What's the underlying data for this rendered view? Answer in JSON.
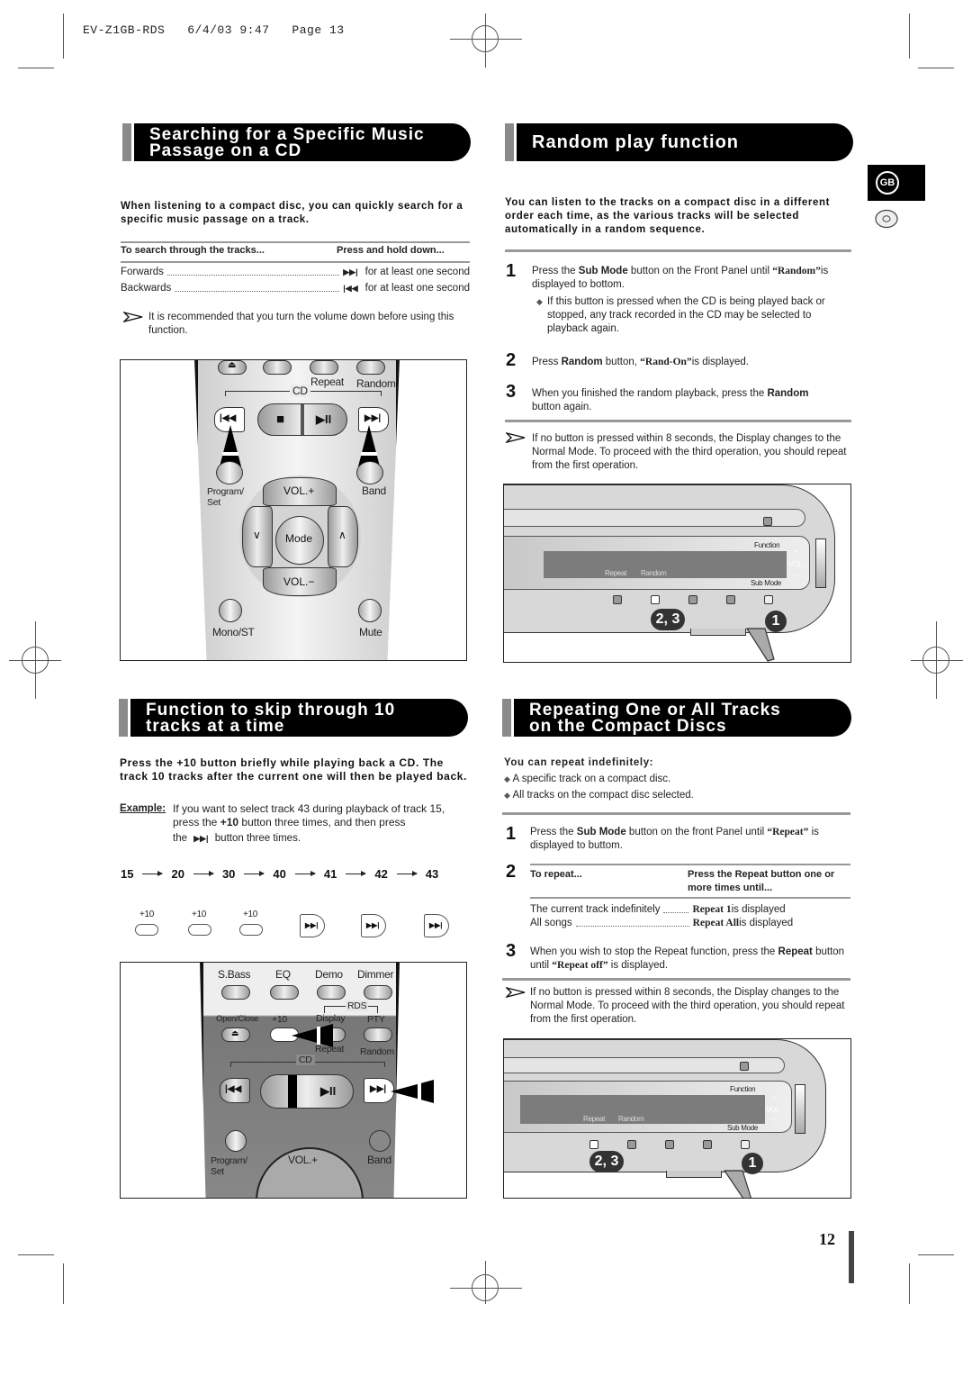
{
  "print_header": "EV-Z1GB-RDS   6/4/03 9:47   Page 13",
  "language_tab": "GB",
  "page_number": "12",
  "search_section": {
    "title_line1": "Searching for a Specific Music",
    "title_line2": "Passage on a CD",
    "intro": "When listening to a compact disc, you can quickly search for a specific music passage on a track.",
    "table": {
      "header_left": "To search through the tracks...",
      "header_right": "Press and hold down...",
      "rows": [
        {
          "direction": "Forwards",
          "icon": "skip-forward-icon",
          "glyph": "▶▶|",
          "duration": "for at least one second"
        },
        {
          "direction": "Backwards",
          "icon": "skip-back-icon",
          "glyph": "|◀◀",
          "duration": "for at least one second"
        }
      ]
    },
    "note": "It is recommended that you turn the volume down before using this function."
  },
  "remote_1": {
    "cd_label": "CD",
    "repeat": "Repeat",
    "random": "Random",
    "eject_glyph": "⏏",
    "stop_glyph": "■",
    "play_pause_glyph": "▶II",
    "prev_glyph": "|◀◀",
    "next_glyph": "▶▶|",
    "program_set": "Program/\nSet",
    "band": "Band",
    "vol_up": "VOL.+",
    "vol_down": "VOL.−",
    "mode": "Mode",
    "down": "∨",
    "up": "∧",
    "mono_st": "Mono/ST",
    "mute": "Mute"
  },
  "random_section": {
    "title": "Random play function",
    "intro": "You can listen to the tracks on a compact disc in a different order each time, as the various tracks will be selected automatically in a random sequence.",
    "steps": [
      {
        "num": "1",
        "pre": "Press the ",
        "bold": "Sub Mode",
        "mid": " button on the Front Panel until ",
        "serif": "“Random”",
        "post": "is displayed to bottom."
      },
      {
        "num": "2",
        "pre": "Press ",
        "bold": "Random",
        "mid": " button, ",
        "serif": "“Rand-On”",
        "post": "is displayed."
      },
      {
        "num": "3",
        "pre": "When you finished the random playback, press the ",
        "bold": "Random",
        "post": " button again."
      }
    ],
    "step1_sub": "If this button is pressed when the CD is being played back or stopped, any track recorded in the CD may be selected to playback again.",
    "note": "If no button is pressed within 8 seconds, the Display changes to the Normal Mode. To proceed with the third operation, you should repeat from the first operation."
  },
  "panel_1": {
    "function": "Function",
    "repeat": "Repeat",
    "random": "Random",
    "sub_mode": "Sub Mode",
    "vol": "VOL.",
    "plus": "+",
    "minus": "—",
    "badge_a": "2, 3",
    "badge_b": "1"
  },
  "skip_section": {
    "title_line1": "Function to skip through 10",
    "title_line2": "tracks at a time",
    "intro": "Press the +10 button briefly while playing back a CD. The track 10 tracks after the current one will then be played back.",
    "example_label": "Example:",
    "example_pre": "If you want to select track 43 during playback of track 15, press the ",
    "example_bold": "+10",
    "example_mid": " button three times, and then press",
    "example_the": "the",
    "example_post": "button three times.",
    "sequence": [
      "15",
      "20",
      "30",
      "40",
      "41",
      "42",
      "43"
    ],
    "plus10_labels": [
      "+10",
      "+10",
      "+10"
    ],
    "next_glyph": "▶▶|"
  },
  "remote_2": {
    "sbass": "S.Bass",
    "eq": "EQ",
    "demo": "Demo",
    "dimmer": "Dimmer",
    "rds": "RDS",
    "open_close": "Open/Close",
    "plus10": "+10",
    "display": "Display",
    "pty": "PTY",
    "repeat": "Repeat",
    "random": "Random",
    "cd_label": "CD",
    "program_set": "Program/\nSet",
    "vol_up": "VOL.+",
    "band": "Band",
    "eject_glyph": "⏏",
    "prev_glyph": "|◀◀",
    "next_glyph": "▶▶|",
    "play_pause_glyph": "▶II"
  },
  "repeat_section": {
    "title_line1": "Repeating One or All Tracks",
    "title_line2": "on the Compact Discs",
    "subhead": "You can repeat indefinitely:",
    "bullets": [
      "A specific track on a compact disc.",
      "All tracks on the compact disc selected."
    ],
    "step1": {
      "num": "1",
      "pre": "Press the ",
      "bold": "Sub Mode",
      "mid": " button on the front Panel until ",
      "serif": "“Repeat”",
      "post": " is displayed to buttom."
    },
    "step2": {
      "num": "2",
      "header_left": "To repeat...",
      "header_right": "Press the Repeat button one or more times until...",
      "rows": [
        {
          "what": "The current track indefinitely",
          "result_serif": "Repeat 1",
          "result_post": " is displayed"
        },
        {
          "what": "All songs",
          "result_serif": "Repeat All",
          "result_post": " is displayed"
        }
      ]
    },
    "step3": {
      "num": "3",
      "pre": "When you wish to stop the Repeat function, press the ",
      "bold": "Repeat",
      "mid": " button until ",
      "serif": "“Repeat off”",
      "post": " is displayed."
    },
    "note": "If no button is pressed within 8 seconds, the Display changes to the Normal Mode. To proceed with the third operation, you should repeat from the first operation."
  },
  "panel_2": {
    "function": "Function",
    "repeat": "Repeat",
    "random": "Random",
    "sub_mode": "Sub Mode",
    "vol": "VOL.",
    "plus": "+",
    "minus": "—",
    "badge_a": "2, 3",
    "badge_b": "1"
  }
}
